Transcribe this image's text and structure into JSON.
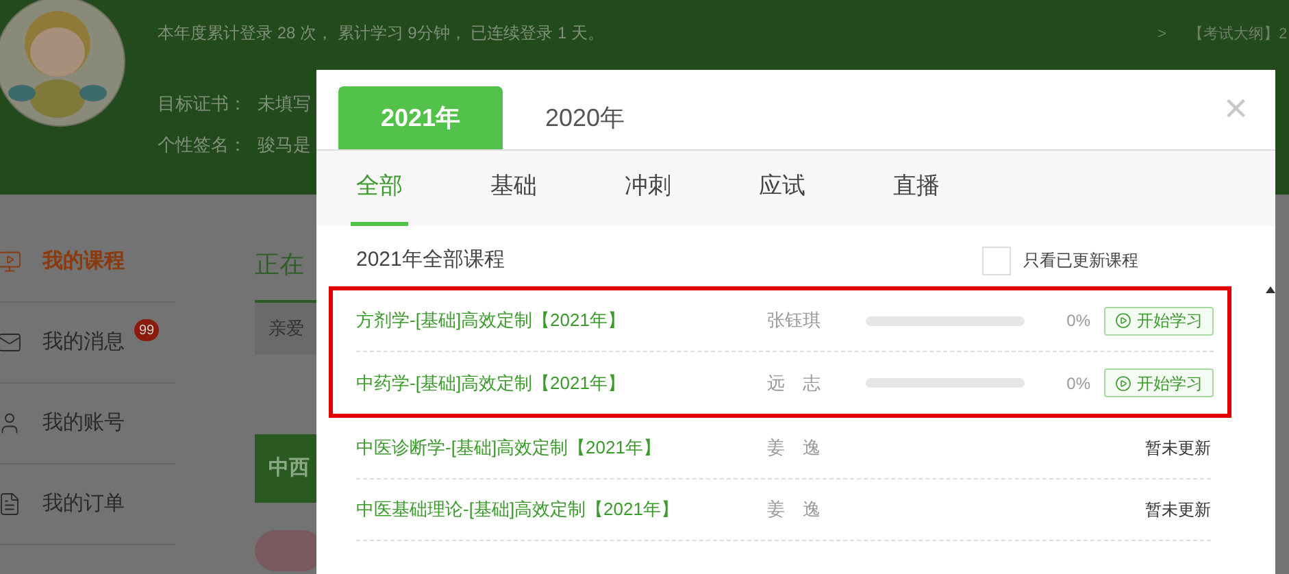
{
  "header": {
    "stats": "本年度累计登录 28 次， 累计学习 9分钟， 已连续登录 1 天。",
    "target_label": "目标证书：",
    "target_value": "未填写",
    "signature_label": "个性签名：",
    "signature_value": "骏马是",
    "news_arrow": ">",
    "news": "【考试大纲】2"
  },
  "sidebar": {
    "items": [
      {
        "label": "我的课程",
        "selected": true,
        "kind": "course"
      },
      {
        "label": "我的消息",
        "selected": false,
        "kind": "mail",
        "badge": "99"
      },
      {
        "label": "我的账号",
        "selected": false,
        "kind": "user"
      },
      {
        "label": "我的订单",
        "selected": false,
        "kind": "order"
      }
    ]
  },
  "content": {
    "section_title": "正在",
    "notice": "亲爱",
    "banner": "中西"
  },
  "modal": {
    "close": "×",
    "year_tabs": [
      {
        "label": "2021年",
        "selected": true
      },
      {
        "label": "2020年",
        "selected": false
      }
    ],
    "category_tabs": [
      {
        "label": "全部",
        "selected": true
      },
      {
        "label": "基础",
        "selected": false
      },
      {
        "label": "冲刺",
        "selected": false
      },
      {
        "label": "应试",
        "selected": false
      },
      {
        "label": "直播",
        "selected": false
      }
    ],
    "list_title": "2021年全部课程",
    "filter": {
      "label": "只看已更新课程",
      "checked": false
    },
    "courses": [
      {
        "title": "方剂学-[基础]高效定制【2021年】",
        "teacher": "张钰琪",
        "kind": "progress",
        "level": 0,
        "percent": "0%",
        "action": "开始学习",
        "highlighted": true
      },
      {
        "title": "中药学-[基础]高效定制【2021年】",
        "teacher": "远　志",
        "kind": "progress",
        "level": 0,
        "percent": "0%",
        "action": "开始学习",
        "highlighted": true
      },
      {
        "title": "中医诊断学-[基础]高效定制【2021年】",
        "teacher": "姜　逸",
        "kind": "status",
        "status": "暂未更新",
        "highlighted": false
      },
      {
        "title": "中医基础理论-[基础]高效定制【2021年】",
        "teacher": "姜　逸",
        "kind": "status",
        "status": "暂未更新",
        "highlighted": false
      }
    ]
  }
}
